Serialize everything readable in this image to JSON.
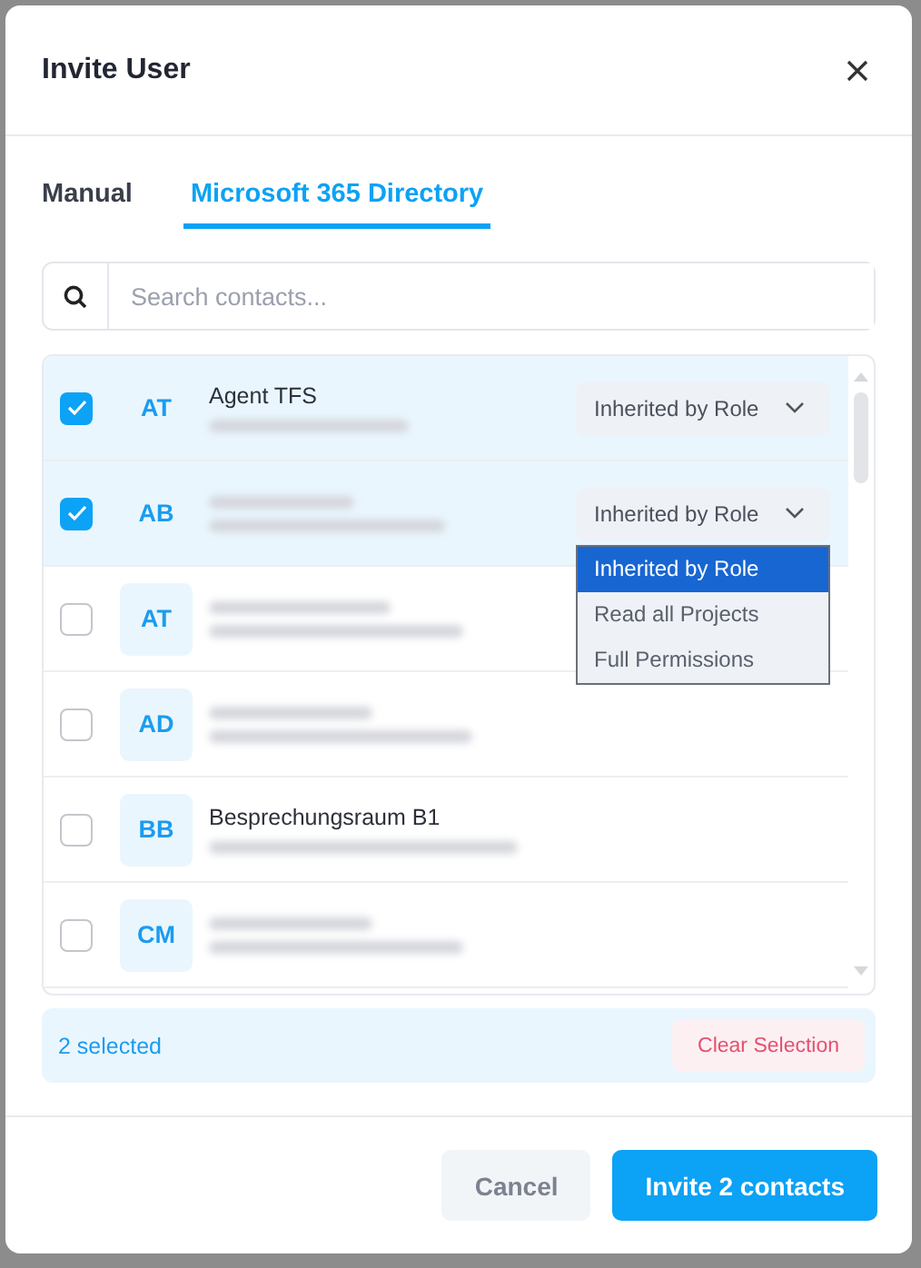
{
  "dialog": {
    "title": "Invite User"
  },
  "tabs": [
    {
      "label": "Manual",
      "selected": false
    },
    {
      "label": "Microsoft 365 Directory",
      "selected": true
    }
  ],
  "search": {
    "placeholder": "Search contacts..."
  },
  "contacts": [
    {
      "initials": "AT",
      "name": "Agent TFS",
      "checked": true,
      "permission": {
        "value": "Inherited by Role"
      }
    },
    {
      "initials": "AB",
      "checked": true,
      "permission": {
        "value": "Inherited by Role",
        "open_menu": [
          {
            "label": "Inherited by Role",
            "selected": true
          },
          {
            "label": "Read all Projects",
            "selected": false
          },
          {
            "label": "Full Permissions",
            "selected": false
          }
        ]
      }
    },
    {
      "initials": "AT",
      "checked": false
    },
    {
      "initials": "AD",
      "checked": false
    },
    {
      "initials": "BB",
      "name": "Besprechungsraum B1",
      "checked": false
    },
    {
      "initials": "CM",
      "checked": false
    }
  ],
  "selection": {
    "count": "2 selected",
    "clear": "Clear Selection"
  },
  "buttons": [
    {
      "label": "Cancel",
      "kind": "secondary"
    },
    {
      "label": "Invite 2 contacts",
      "kind": "primary"
    }
  ]
}
